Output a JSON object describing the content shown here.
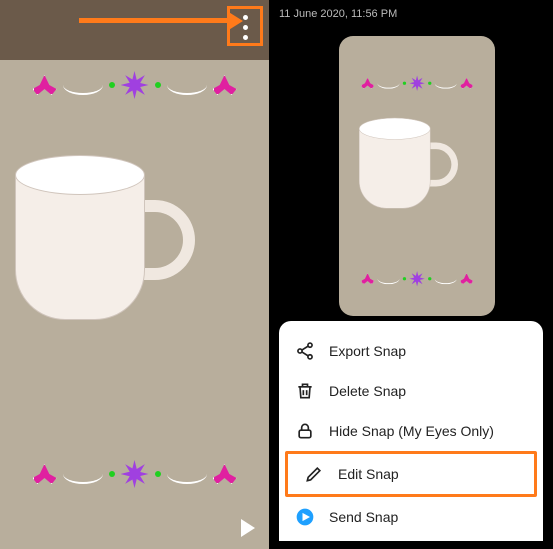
{
  "left": {
    "more_icon_name": "more-vertical-icon"
  },
  "right": {
    "timestamp": "11 June 2020, 11:56 PM",
    "menu": {
      "items": [
        {
          "label": "Export Snap",
          "icon": "share-icon"
        },
        {
          "label": "Delete Snap",
          "icon": "trash-icon"
        },
        {
          "label": "Hide Snap (My Eyes Only)",
          "icon": "lock-icon"
        },
        {
          "label": "Edit Snap",
          "icon": "pencil-icon"
        },
        {
          "label": "Send Snap",
          "icon": "send-circle-icon"
        }
      ],
      "highlighted_index": 3
    }
  },
  "annotation": {
    "arrow_color": "#ff7a1a",
    "highlight_color": "#ff7a1a"
  }
}
